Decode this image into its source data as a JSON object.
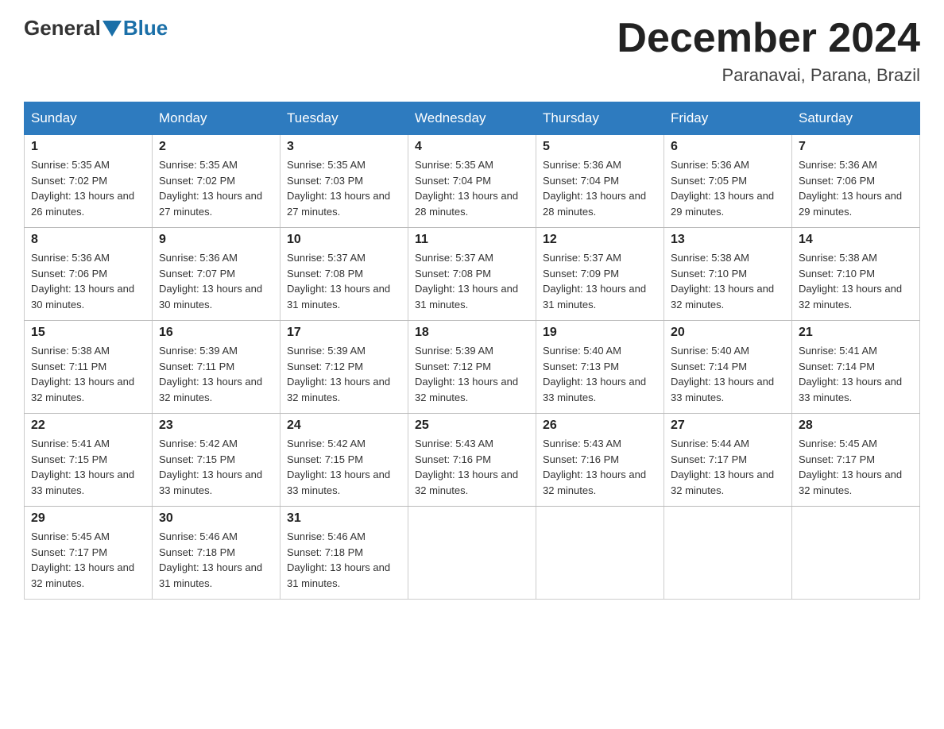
{
  "header": {
    "logo": {
      "general": "General",
      "blue": "Blue"
    },
    "title": "December 2024",
    "location": "Paranavai, Parana, Brazil"
  },
  "calendar": {
    "headers": [
      "Sunday",
      "Monday",
      "Tuesday",
      "Wednesday",
      "Thursday",
      "Friday",
      "Saturday"
    ],
    "weeks": [
      [
        {
          "day": "1",
          "sunrise": "5:35 AM",
          "sunset": "7:02 PM",
          "daylight": "13 hours and 26 minutes."
        },
        {
          "day": "2",
          "sunrise": "5:35 AM",
          "sunset": "7:02 PM",
          "daylight": "13 hours and 27 minutes."
        },
        {
          "day": "3",
          "sunrise": "5:35 AM",
          "sunset": "7:03 PM",
          "daylight": "13 hours and 27 minutes."
        },
        {
          "day": "4",
          "sunrise": "5:35 AM",
          "sunset": "7:04 PM",
          "daylight": "13 hours and 28 minutes."
        },
        {
          "day": "5",
          "sunrise": "5:36 AM",
          "sunset": "7:04 PM",
          "daylight": "13 hours and 28 minutes."
        },
        {
          "day": "6",
          "sunrise": "5:36 AM",
          "sunset": "7:05 PM",
          "daylight": "13 hours and 29 minutes."
        },
        {
          "day": "7",
          "sunrise": "5:36 AM",
          "sunset": "7:06 PM",
          "daylight": "13 hours and 29 minutes."
        }
      ],
      [
        {
          "day": "8",
          "sunrise": "5:36 AM",
          "sunset": "7:06 PM",
          "daylight": "13 hours and 30 minutes."
        },
        {
          "day": "9",
          "sunrise": "5:36 AM",
          "sunset": "7:07 PM",
          "daylight": "13 hours and 30 minutes."
        },
        {
          "day": "10",
          "sunrise": "5:37 AM",
          "sunset": "7:08 PM",
          "daylight": "13 hours and 31 minutes."
        },
        {
          "day": "11",
          "sunrise": "5:37 AM",
          "sunset": "7:08 PM",
          "daylight": "13 hours and 31 minutes."
        },
        {
          "day": "12",
          "sunrise": "5:37 AM",
          "sunset": "7:09 PM",
          "daylight": "13 hours and 31 minutes."
        },
        {
          "day": "13",
          "sunrise": "5:38 AM",
          "sunset": "7:10 PM",
          "daylight": "13 hours and 32 minutes."
        },
        {
          "day": "14",
          "sunrise": "5:38 AM",
          "sunset": "7:10 PM",
          "daylight": "13 hours and 32 minutes."
        }
      ],
      [
        {
          "day": "15",
          "sunrise": "5:38 AM",
          "sunset": "7:11 PM",
          "daylight": "13 hours and 32 minutes."
        },
        {
          "day": "16",
          "sunrise": "5:39 AM",
          "sunset": "7:11 PM",
          "daylight": "13 hours and 32 minutes."
        },
        {
          "day": "17",
          "sunrise": "5:39 AM",
          "sunset": "7:12 PM",
          "daylight": "13 hours and 32 minutes."
        },
        {
          "day": "18",
          "sunrise": "5:39 AM",
          "sunset": "7:12 PM",
          "daylight": "13 hours and 32 minutes."
        },
        {
          "day": "19",
          "sunrise": "5:40 AM",
          "sunset": "7:13 PM",
          "daylight": "13 hours and 33 minutes."
        },
        {
          "day": "20",
          "sunrise": "5:40 AM",
          "sunset": "7:14 PM",
          "daylight": "13 hours and 33 minutes."
        },
        {
          "day": "21",
          "sunrise": "5:41 AM",
          "sunset": "7:14 PM",
          "daylight": "13 hours and 33 minutes."
        }
      ],
      [
        {
          "day": "22",
          "sunrise": "5:41 AM",
          "sunset": "7:15 PM",
          "daylight": "13 hours and 33 minutes."
        },
        {
          "day": "23",
          "sunrise": "5:42 AM",
          "sunset": "7:15 PM",
          "daylight": "13 hours and 33 minutes."
        },
        {
          "day": "24",
          "sunrise": "5:42 AM",
          "sunset": "7:15 PM",
          "daylight": "13 hours and 33 minutes."
        },
        {
          "day": "25",
          "sunrise": "5:43 AM",
          "sunset": "7:16 PM",
          "daylight": "13 hours and 32 minutes."
        },
        {
          "day": "26",
          "sunrise": "5:43 AM",
          "sunset": "7:16 PM",
          "daylight": "13 hours and 32 minutes."
        },
        {
          "day": "27",
          "sunrise": "5:44 AM",
          "sunset": "7:17 PM",
          "daylight": "13 hours and 32 minutes."
        },
        {
          "day": "28",
          "sunrise": "5:45 AM",
          "sunset": "7:17 PM",
          "daylight": "13 hours and 32 minutes."
        }
      ],
      [
        {
          "day": "29",
          "sunrise": "5:45 AM",
          "sunset": "7:17 PM",
          "daylight": "13 hours and 32 minutes."
        },
        {
          "day": "30",
          "sunrise": "5:46 AM",
          "sunset": "7:18 PM",
          "daylight": "13 hours and 31 minutes."
        },
        {
          "day": "31",
          "sunrise": "5:46 AM",
          "sunset": "7:18 PM",
          "daylight": "13 hours and 31 minutes."
        },
        null,
        null,
        null,
        null
      ]
    ]
  }
}
